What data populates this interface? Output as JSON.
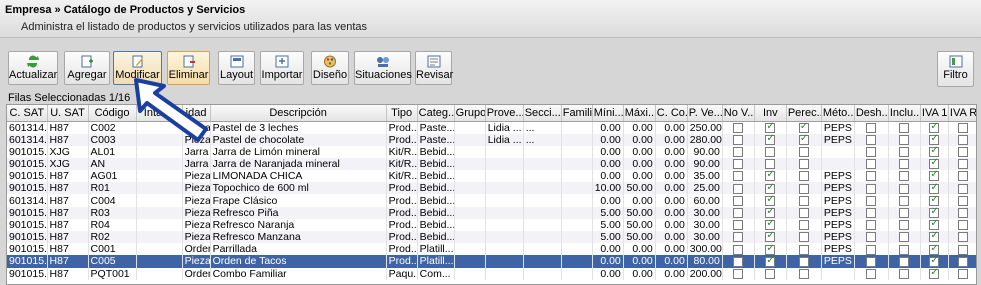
{
  "header": {
    "title": "Empresa » Catálogo de Productos y Servicios",
    "subtitle": "Administra el listado de productos y servicios utilizados para las ventas"
  },
  "toolbar": {
    "actualizar": "Actualizar",
    "agregar": "Agregar",
    "modificar": "Modificar",
    "eliminar": "Eliminar",
    "layout": "Layout",
    "importar": "Importar",
    "diseno": "Diseño",
    "situaciones": "Situaciones",
    "revisar": "Revisar",
    "filtro": "Filtro"
  },
  "selection": {
    "label": "Filas Seleccionadas  1/16"
  },
  "table": {
    "columns": [
      "C. SAT",
      "U. SAT",
      "Código",
      "Intario",
      "idad",
      "Descripción",
      "Tipo",
      "Categ...",
      "Grupo",
      "Prove...",
      "Secci...",
      "Familia",
      "Míni...",
      "Máxi...",
      "C. Co...",
      "P. Ve...",
      "No V...",
      "Inv",
      "Perec...",
      "Méto...",
      "Desh...",
      "Inclu...",
      "IVA 16",
      "IVA R..."
    ],
    "rows": [
      {
        "csat": "601314...",
        "usat": "H87",
        "codigo": "C002",
        "unidad": "Pieza",
        "descripcion": "Pastel de 3 leches",
        "tipo": "Prod...",
        "categ": "Paste...",
        "grupo": "",
        "prove": "Lidia ...",
        "secci": "...",
        "min": "0.00",
        "max": "0.00",
        "cco": "0.00",
        "pve": "250.00",
        "nov": false,
        "inv": true,
        "perec": true,
        "metodo": "PEPS",
        "desh": false,
        "inclu": false,
        "iva16": true,
        "ivar": false
      },
      {
        "csat": "601314...",
        "usat": "H87",
        "codigo": "C003",
        "unidad": "Pieza",
        "descripcion": "Pastel de chocolate",
        "tipo": "Prod...",
        "categ": "Paste...",
        "grupo": "",
        "prove": "Lidia ...",
        "secci": "...",
        "min": "0.00",
        "max": "0.00",
        "cco": "0.00",
        "pve": "280.00",
        "nov": false,
        "inv": true,
        "perec": true,
        "metodo": "PEPS",
        "desh": false,
        "inclu": false,
        "iva16": true,
        "ivar": false
      },
      {
        "csat": "901015...",
        "usat": "XJG",
        "codigo": "AL01",
        "unidad": "Jarra",
        "descripcion": "Jarra de Limón mineral",
        "tipo": "Kit/R...",
        "categ": "Bebid...",
        "grupo": "",
        "prove": "",
        "secci": "",
        "min": "0.00",
        "max": "0.00",
        "cco": "0.00",
        "pve": "90.00",
        "nov": false,
        "inv": false,
        "perec": false,
        "metodo": "",
        "desh": false,
        "inclu": false,
        "iva16": true,
        "ivar": false
      },
      {
        "csat": "901015...",
        "usat": "XJG",
        "codigo": "AN",
        "unidad": "Jarra",
        "descripcion": "Jarra de Naranjada mineral",
        "tipo": "Kit/R...",
        "categ": "Bebid...",
        "grupo": "",
        "prove": "",
        "secci": "",
        "min": "0.00",
        "max": "0.00",
        "cco": "0.00",
        "pve": "90.00",
        "nov": false,
        "inv": false,
        "perec": false,
        "metodo": "",
        "desh": false,
        "inclu": false,
        "iva16": true,
        "ivar": false
      },
      {
        "csat": "901015...",
        "usat": "H87",
        "codigo": "AG01",
        "unidad": "Pieza",
        "descripcion": "LIMONADA CHICA",
        "tipo": "Kit/R...",
        "categ": "Bebid...",
        "grupo": "",
        "prove": "",
        "secci": "",
        "min": "0.00",
        "max": "0.00",
        "cco": "0.00",
        "pve": "35.00",
        "nov": false,
        "inv": true,
        "perec": false,
        "metodo": "PEPS",
        "desh": false,
        "inclu": false,
        "iva16": true,
        "ivar": false
      },
      {
        "csat": "901015...",
        "usat": "H87",
        "codigo": "R01",
        "unidad": "Pieza",
        "descripcion": "Topochico de 600 ml",
        "tipo": "Prod...",
        "categ": "Bebid...",
        "grupo": "",
        "prove": "",
        "secci": "",
        "min": "10.00",
        "max": "50.00",
        "cco": "0.00",
        "pve": "25.00",
        "nov": false,
        "inv": true,
        "perec": false,
        "metodo": "PEPS",
        "desh": false,
        "inclu": false,
        "iva16": true,
        "ivar": false
      },
      {
        "csat": "601314...",
        "usat": "H87",
        "codigo": "C004",
        "unidad": "Pieza",
        "descripcion": "Frape Clásico",
        "tipo": "Prod...",
        "categ": "Bebid...",
        "grupo": "",
        "prove": "",
        "secci": "",
        "min": "0.00",
        "max": "0.00",
        "cco": "0.00",
        "pve": "60.00",
        "nov": false,
        "inv": true,
        "perec": false,
        "metodo": "PEPS",
        "desh": false,
        "inclu": false,
        "iva16": true,
        "ivar": false
      },
      {
        "csat": "901015...",
        "usat": "H87",
        "codigo": "R03",
        "unidad": "Pieza",
        "descripcion": "Refresco Piña",
        "tipo": "Prod...",
        "categ": "Bebid...",
        "grupo": "",
        "prove": "",
        "secci": "",
        "min": "5.00",
        "max": "50.00",
        "cco": "0.00",
        "pve": "30.00",
        "nov": false,
        "inv": true,
        "perec": false,
        "metodo": "PEPS",
        "desh": false,
        "inclu": false,
        "iva16": true,
        "ivar": false
      },
      {
        "csat": "901015...",
        "usat": "H87",
        "codigo": "R04",
        "unidad": "Pieza",
        "descripcion": "Refresco  Naranja",
        "tipo": "Prod...",
        "categ": "Bebid...",
        "grupo": "",
        "prove": "",
        "secci": "",
        "min": "5.00",
        "max": "50.00",
        "cco": "0.00",
        "pve": "30.00",
        "nov": false,
        "inv": true,
        "perec": false,
        "metodo": "PEPS",
        "desh": false,
        "inclu": false,
        "iva16": true,
        "ivar": false
      },
      {
        "csat": "901015...",
        "usat": "H87",
        "codigo": "R02",
        "unidad": "Pieza",
        "descripcion": "Refresco  Manzana",
        "tipo": "Prod...",
        "categ": "Bebid...",
        "grupo": "",
        "prove": "",
        "secci": "",
        "min": "5.00",
        "max": "50.00",
        "cco": "0.00",
        "pve": "30.00",
        "nov": false,
        "inv": true,
        "perec": false,
        "metodo": "PEPS",
        "desh": false,
        "inclu": false,
        "iva16": true,
        "ivar": false
      },
      {
        "csat": "901015...",
        "usat": "H87",
        "codigo": "C001",
        "unidad": "Orden",
        "descripcion": "Parrillada",
        "tipo": "Prod...",
        "categ": "Platill...",
        "grupo": "",
        "prove": "",
        "secci": "",
        "min": "0.00",
        "max": "0.00",
        "cco": "0.00",
        "pve": "300.00",
        "nov": false,
        "inv": true,
        "perec": false,
        "metodo": "PEPS",
        "desh": false,
        "inclu": false,
        "iva16": true,
        "ivar": false
      },
      {
        "csat": "901015...",
        "usat": "H87",
        "codigo": "C005",
        "unidad": "Pieza",
        "descripcion": "Orden de Tacos",
        "tipo": "Prod...",
        "categ": "Platill...",
        "grupo": "",
        "prove": "",
        "secci": "",
        "min": "0.00",
        "max": "0.00",
        "cco": "0.00",
        "pve": "80.00",
        "nov": false,
        "inv": true,
        "perec": false,
        "metodo": "PEPS",
        "desh": false,
        "inclu": false,
        "iva16": true,
        "ivar": false,
        "highlight": true
      },
      {
        "csat": "901015...",
        "usat": "H87",
        "codigo": "PQT001",
        "unidad": "Orden",
        "descripcion": "Combo Familiar",
        "tipo": "Paqu...",
        "categ": "Com...",
        "grupo": "",
        "prove": "",
        "secci": "",
        "min": "0.00",
        "max": "0.00",
        "cco": "0.00",
        "pve": "200.00",
        "nov": false,
        "inv": false,
        "perec": false,
        "metodo": "",
        "desh": false,
        "inclu": false,
        "iva16": true,
        "ivar": false
      }
    ]
  },
  "colors": {
    "highlight": "#3e64a6",
    "accent": "#1a3fa0"
  }
}
